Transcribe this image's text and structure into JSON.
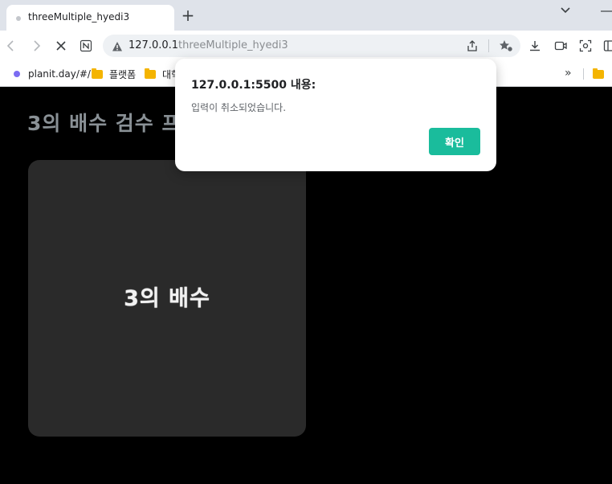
{
  "tab": {
    "title": "threeMultiple_hyedi3",
    "new_tab": "+"
  },
  "omnibox": {
    "host": "127.0.0.1",
    "path": "threeMultiple_hyedi3"
  },
  "bookmarks": {
    "items": [
      {
        "label": "planit.day/#/",
        "icon": "site-dot-icon"
      },
      {
        "label": "플랫폼",
        "icon": "folder-icon"
      },
      {
        "label": "대학",
        "icon": "folder-icon"
      }
    ],
    "more": "»"
  },
  "page": {
    "title": "3의 배수 검수 프로그램",
    "card_label": "3의 배수"
  },
  "dialog": {
    "title": "127.0.0.1:5500 내용:",
    "message": "입력이 취소되었습니다.",
    "ok_label": "확인"
  },
  "colors": {
    "accent": "#1abc9c",
    "page_bg": "#000000",
    "card_bg": "#2a2a2a"
  }
}
